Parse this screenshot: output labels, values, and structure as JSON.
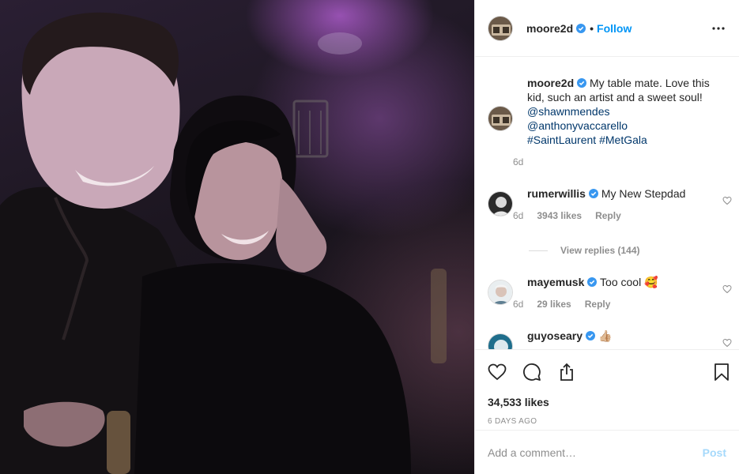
{
  "header": {
    "username": "moore2d",
    "separator": "•",
    "follow_label": "Follow",
    "avatar_icon": "user-avatar-icon",
    "verified_icon": "verified-badge-icon",
    "more_icon": "more-options-icon"
  },
  "caption": {
    "username": "moore2d",
    "text": "My table mate. Love this kid, such an artist and a sweet soul!",
    "mentions": [
      "@shawnmendes",
      "@anthonyvaccarello"
    ],
    "hashtags": [
      "#SaintLaurent",
      "#MetGala"
    ],
    "time": "6d"
  },
  "comments": [
    {
      "username": "rumerwillis",
      "text": "My New Stepdad",
      "time": "6d",
      "likes": "3943 likes",
      "reply_label": "Reply",
      "view_replies": "View replies (144)"
    },
    {
      "username": "mayemusk",
      "text": "Too cool 🥰",
      "time": "6d",
      "likes": "29 likes",
      "reply_label": "Reply"
    },
    {
      "username": "guyoseary",
      "text": "👍🏼"
    }
  ],
  "actions": {
    "like_icon": "heart-icon",
    "comment_icon": "comment-icon",
    "share_icon": "share-icon",
    "save_icon": "bookmark-icon",
    "likes": "34,533 likes",
    "date": "6 DAYS AGO"
  },
  "add_comment": {
    "placeholder": "Add a comment…",
    "post_label": "Post"
  },
  "colors": {
    "accent": "#0095f6",
    "link": "#00376b",
    "muted": "#8e8e8e",
    "text": "#262626",
    "border": "#efefef"
  }
}
